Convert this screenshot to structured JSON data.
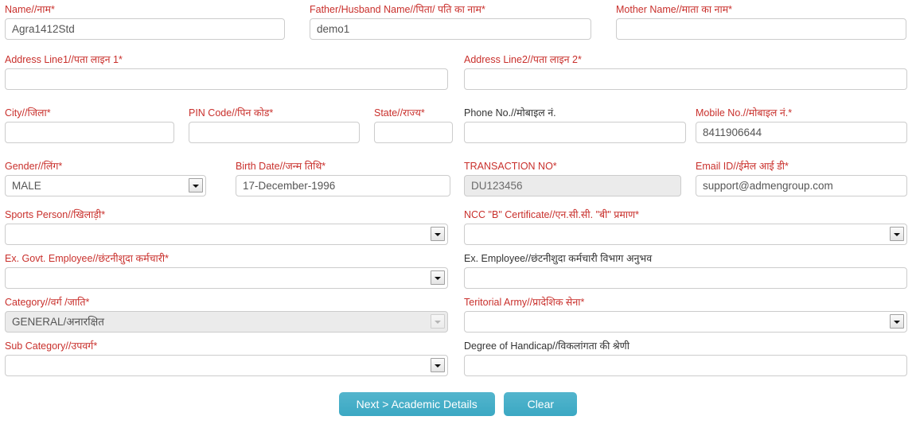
{
  "form": {
    "fields": [
      {
        "key": "name",
        "label": "Name//नाम*",
        "value": "Agra1412Std",
        "placeholder": "",
        "required": true,
        "type": "text",
        "state": "enabled"
      },
      {
        "key": "father_husband_name",
        "label": "Father/Husband Name//पिता/ पति का नाम*",
        "value": "demo1",
        "placeholder": "",
        "required": true,
        "type": "text",
        "state": "enabled"
      },
      {
        "key": "mother_name",
        "label": "Mother Name//माता का नाम*",
        "value": "",
        "placeholder": "",
        "required": true,
        "type": "text",
        "state": "enabled"
      },
      {
        "key": "address_line1",
        "label": "Address Line1//पता लाइन 1*",
        "value": "",
        "placeholder": "",
        "required": true,
        "type": "text",
        "state": "enabled"
      },
      {
        "key": "address_line2",
        "label": "Address Line2//पता लाइन 2*",
        "value": "",
        "placeholder": "",
        "required": true,
        "type": "text",
        "state": "enabled"
      },
      {
        "key": "city",
        "label": "City//जिला*",
        "value": "",
        "placeholder": "",
        "required": true,
        "type": "text",
        "state": "enabled"
      },
      {
        "key": "pin_code",
        "label": "PIN Code//पिन कोड*",
        "value": "",
        "placeholder": "",
        "required": true,
        "type": "text",
        "state": "enabled"
      },
      {
        "key": "state",
        "label": "State//राज्य*",
        "value": "",
        "placeholder": "",
        "required": true,
        "type": "text",
        "state": "enabled"
      },
      {
        "key": "phone_no",
        "label": "Phone No.//मोबाइल नं.",
        "value": "",
        "placeholder": "",
        "required": false,
        "type": "text",
        "state": "enabled"
      },
      {
        "key": "mobile_no",
        "label": "Mobile No.//मोबाइल नं.*",
        "value": "8411906644",
        "placeholder": "",
        "required": true,
        "type": "text",
        "state": "enabled"
      },
      {
        "key": "gender",
        "label": "Gender//लिंग*",
        "value": "MALE",
        "placeholder": "",
        "required": true,
        "type": "select",
        "state": "enabled"
      },
      {
        "key": "birth_date",
        "label": "Birth Date//जन्म तिथि*",
        "value": "17-December-1996",
        "placeholder": "",
        "required": true,
        "type": "text",
        "state": "enabled"
      },
      {
        "key": "transaction_no",
        "label": "TRANSACTION NO*",
        "value": "DU123456",
        "placeholder": "",
        "required": true,
        "type": "text",
        "state": "disabled"
      },
      {
        "key": "email_id",
        "label": "Email ID//ईमेल आई डी*",
        "value": "support@admengroup.com",
        "placeholder": "",
        "required": true,
        "type": "text",
        "state": "enabled"
      },
      {
        "key": "sports_person",
        "label": "Sports Person//खिलाड़ी*",
        "value": "",
        "placeholder": "",
        "required": true,
        "type": "select",
        "state": "enabled"
      },
      {
        "key": "ncc_b_certificate",
        "label": "NCC \"B\" Certificate//एन.सी.सी. \"बी\" प्रमाण*",
        "value": "",
        "placeholder": "",
        "required": true,
        "type": "select",
        "state": "enabled"
      },
      {
        "key": "ex_govt_employee",
        "label": "Ex. Govt. Employee//छंटनीशुदा कर्मचारी*",
        "value": "",
        "placeholder": "",
        "required": true,
        "type": "select",
        "state": "enabled"
      },
      {
        "key": "ex_employee_dept_experience",
        "label": "Ex. Employee//छंटनीशुदा कर्मचारी विभाग अनुभव",
        "value": "",
        "placeholder": "",
        "required": false,
        "type": "text",
        "state": "enabled"
      },
      {
        "key": "category",
        "label": "Category//वर्ग /जाति*",
        "value": "GENERAL/अनारक्षित",
        "placeholder": "",
        "required": true,
        "type": "select",
        "state": "disabled"
      },
      {
        "key": "teritorial_army",
        "label": "Teritorial Army//प्रादेशिक सेना*",
        "value": "",
        "placeholder": "",
        "required": true,
        "type": "select",
        "state": "enabled"
      },
      {
        "key": "sub_category",
        "label": "Sub Category//उपवर्ग*",
        "value": "",
        "placeholder": "",
        "required": true,
        "type": "select",
        "state": "enabled"
      },
      {
        "key": "degree_of_handicap",
        "label": "Degree of Handicap//विकलांगता की श्रेणी",
        "value": "",
        "placeholder": "",
        "required": false,
        "type": "text",
        "state": "enabled"
      }
    ],
    "buttons": {
      "next_label": "Next > Academic Details",
      "clear_label": "Clear"
    },
    "colors": {
      "required_label": "#c9302c",
      "optional_label": "#333333",
      "button_bg": "#45aec7",
      "field_border": "#cccccc",
      "disabled_bg": "#ebebeb"
    }
  }
}
